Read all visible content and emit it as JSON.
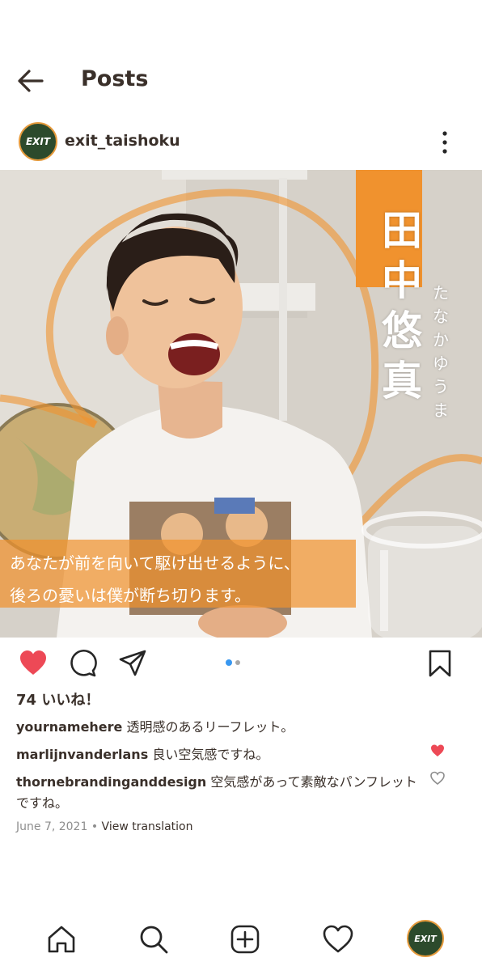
{
  "header": {
    "title": "Posts",
    "back_icon": "arrow-left-icon"
  },
  "post": {
    "username": "exit_taishoku",
    "avatar_text": "EXIT",
    "photo": {
      "name_kanji": [
        "田",
        "中",
        "悠",
        "真"
      ],
      "name_kana": [
        "た",
        "な",
        "か",
        "ゆ",
        "う",
        "ま"
      ],
      "caption_line1": "あなたが前を向いて駆け出せるように、",
      "caption_line2": "後ろの憂いは僕が断ち切ります。"
    },
    "carousel": {
      "count": 2,
      "active": 0
    },
    "likes_text": "74 いいね！",
    "comments": [
      {
        "user": "yournamehere",
        "text": "透明感のあるリーフレット。",
        "liked": null
      },
      {
        "user": "marlijnvanderlans",
        "text": "良い空気感ですね。",
        "liked": true
      },
      {
        "user": "thornebrandinganddesign",
        "text": "空気感があって素敵なパンフレットですね。",
        "liked": false
      }
    ],
    "date": "June 7, 2021",
    "separator": " • ",
    "view_translation": "View translation"
  },
  "colors": {
    "accent_orange": "#f0922e",
    "like_red": "#ed4956",
    "carousel_active": "#3897f0",
    "carousel_inactive": "#a8a8a8",
    "avatar_green": "#2c4a2c"
  },
  "nav": {
    "items": [
      "home-icon",
      "search-icon",
      "add-post-icon",
      "activity-heart-icon",
      "profile-avatar"
    ],
    "avatar_text": "EXIT"
  }
}
